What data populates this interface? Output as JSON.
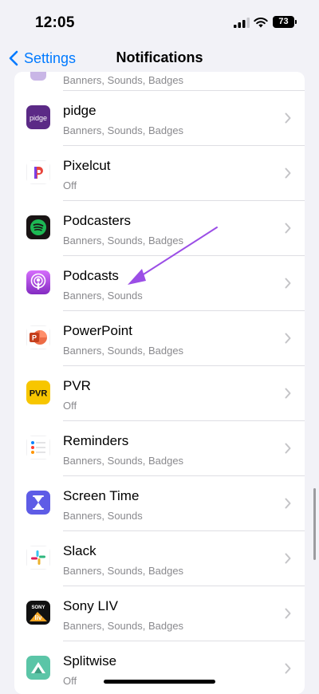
{
  "status_bar": {
    "time": "12:05",
    "battery": "73"
  },
  "nav": {
    "back_label": "Settings",
    "title": "Notifications"
  },
  "top_partial": {
    "subtitle": "Banners, Sounds, Badges"
  },
  "apps": [
    {
      "name": "pidge",
      "subtitle": "Banners, Sounds, Badges",
      "icon": "pidge-icon"
    },
    {
      "name": "Pixelcut",
      "subtitle": "Off",
      "icon": "pixelcut-icon"
    },
    {
      "name": "Podcasters",
      "subtitle": "Banners, Sounds, Badges",
      "icon": "spotify-icon"
    },
    {
      "name": "Podcasts",
      "subtitle": "Banners, Sounds",
      "icon": "podcasts-icon"
    },
    {
      "name": "PowerPoint",
      "subtitle": "Banners, Sounds, Badges",
      "icon": "powerpoint-icon"
    },
    {
      "name": "PVR",
      "subtitle": "Off",
      "icon": "pvr-icon"
    },
    {
      "name": "Reminders",
      "subtitle": "Banners, Sounds, Badges",
      "icon": "reminders-icon"
    },
    {
      "name": "Screen Time",
      "subtitle": "Banners, Sounds",
      "icon": "hourglass-icon"
    },
    {
      "name": "Slack",
      "subtitle": "Banners, Sounds, Badges",
      "icon": "slack-icon"
    },
    {
      "name": "Sony LIV",
      "subtitle": "Banners, Sounds, Badges",
      "icon": "sonyliv-icon"
    },
    {
      "name": "Splitwise",
      "subtitle": "Off",
      "icon": "splitwise-icon"
    }
  ],
  "icon_labels": {
    "pidge": "pidge",
    "pvr": "PVR",
    "sony": "SONY",
    "liv": "liv"
  },
  "colors": {
    "accent": "#007aff",
    "annotation_arrow": "#9b4ee6"
  }
}
